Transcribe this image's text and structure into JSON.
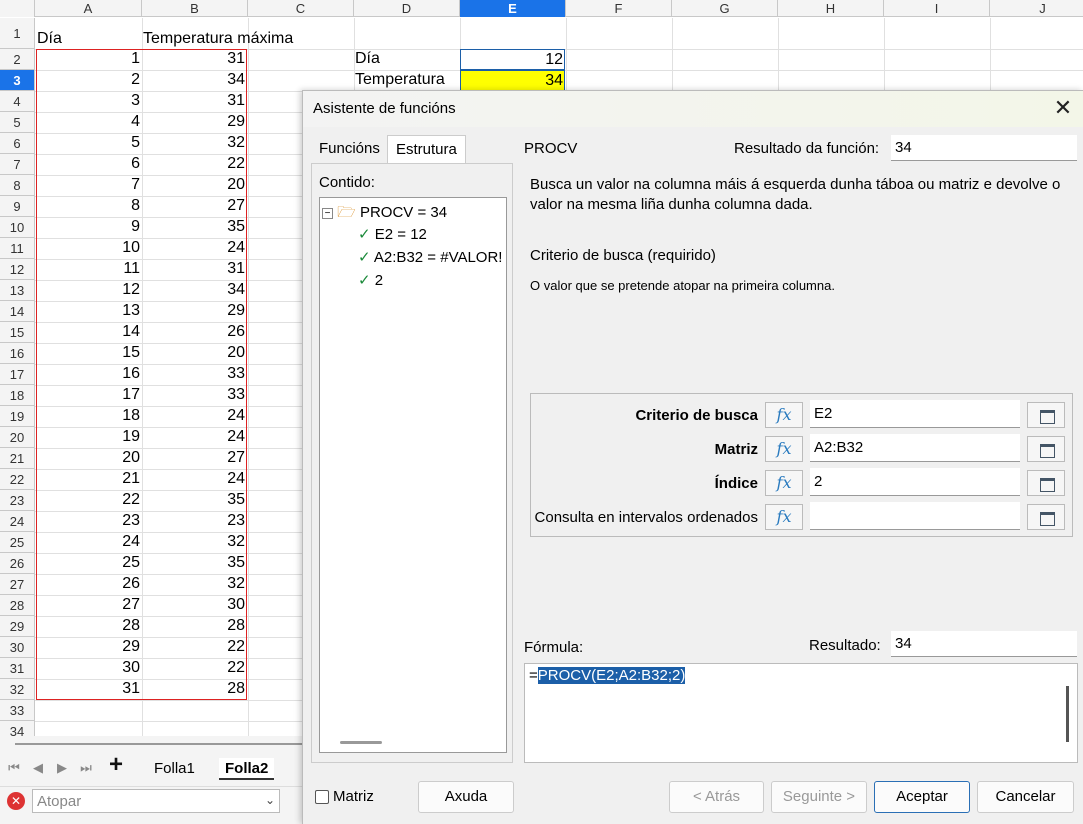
{
  "sheet": {
    "columns": [
      "A",
      "B",
      "C",
      "D",
      "E",
      "F",
      "G",
      "H",
      "I",
      "J"
    ],
    "active_column": "E",
    "rows": [
      "1",
      "2",
      "3",
      "4",
      "5",
      "6",
      "7",
      "8",
      "9",
      "10",
      "11",
      "12",
      "13",
      "14",
      "15",
      "16",
      "17",
      "18",
      "19",
      "20",
      "21",
      "22",
      "23",
      "24",
      "25",
      "26",
      "27",
      "28",
      "29",
      "30",
      "31",
      "32",
      "33",
      "34"
    ],
    "active_row": "3",
    "header_a": "Día",
    "header_b": "Temperatura máxima",
    "days": [
      "1",
      "2",
      "3",
      "4",
      "5",
      "6",
      "7",
      "8",
      "9",
      "10",
      "11",
      "12",
      "13",
      "14",
      "15",
      "16",
      "17",
      "18",
      "19",
      "20",
      "21",
      "22",
      "23",
      "24",
      "25",
      "26",
      "27",
      "28",
      "29",
      "30",
      "31"
    ],
    "temps": [
      "31",
      "34",
      "31",
      "29",
      "32",
      "22",
      "20",
      "27",
      "35",
      "24",
      "31",
      "34",
      "29",
      "26",
      "20",
      "33",
      "33",
      "24",
      "24",
      "27",
      "24",
      "35",
      "23",
      "32",
      "35",
      "32",
      "30",
      "28",
      "22",
      "22",
      "28"
    ],
    "d2_label": "Día",
    "e2_value": "12",
    "d3_label": "Temperatura",
    "e3_value": "34"
  },
  "sheet_tabs": {
    "add": "+",
    "tabs": [
      "Folla1",
      "Folla2"
    ],
    "active": "Folla2"
  },
  "find": {
    "placeholder": "Atopar"
  },
  "dialog": {
    "title": "Asistente de funcións",
    "tabs": [
      "Funcións",
      "Estrutura"
    ],
    "active_tab": "Estrutura",
    "contido_label": "Contido:",
    "tree": [
      "PROCV = 34",
      "E2 = 12",
      "A2:B32 = #VALOR!",
      "2"
    ],
    "function_name": "PROCV",
    "result_label": "Resultado da función:",
    "result_value": "34",
    "description": "Busca un valor na columna máis á esquerda dunha táboa ou matriz e devolve o valor na mesma liña dunha columna dada.",
    "arg_title": "Criterio de busca (requirido)",
    "arg_help": "O valor que se pretende atopar na primeira columna.",
    "args": [
      {
        "label": "Criterio de busca",
        "value": "E2",
        "bold": true
      },
      {
        "label": "Matriz",
        "value": "A2:B32",
        "bold": true
      },
      {
        "label": "Índice",
        "value": "2",
        "bold": true
      },
      {
        "label": "Consulta en intervalos ordenados",
        "value": "",
        "bold": false
      }
    ],
    "fx": "fx",
    "formula_label": "Fórmula:",
    "formula_result_label": "Resultado:",
    "formula_result_value": "34",
    "formula_prefix": "=",
    "formula_selected": "PROCV(E2;A2:B32;2)",
    "matriz_label": "Matriz",
    "buttons": {
      "help": "Axuda",
      "back": "< Atrás",
      "next": "Seguinte >",
      "ok": "Aceptar",
      "cancel": "Cancelar"
    }
  },
  "colors": {
    "accent": "#1a73e8",
    "highlight": "#ffff00",
    "range_border": "#dd2222",
    "selection": "#1c5fa8"
  }
}
